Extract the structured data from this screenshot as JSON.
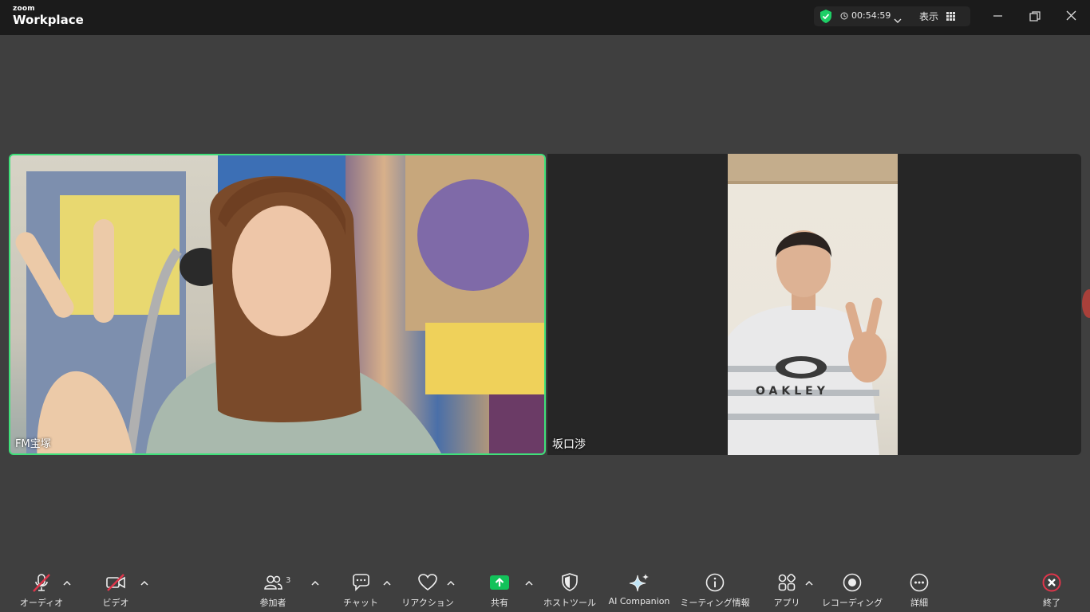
{
  "app": {
    "brand_small": "zoom",
    "brand_name": "Workplace"
  },
  "meeting": {
    "elapsed": "00:54:59",
    "view_label": "表示"
  },
  "participants": [
    {
      "name": "FM宝塚",
      "active_speaker": true
    },
    {
      "name": "坂口渉",
      "active_speaker": false
    }
  ],
  "toolbar": {
    "audio": "オーディオ",
    "video": "ビデオ",
    "participants": "参加者",
    "participants_count": "3",
    "chat": "チャット",
    "reactions": "リアクション",
    "share": "共有",
    "host_tools": "ホストツール",
    "ai_companion": "AI Companion",
    "meeting_info": "ミーティング情報",
    "apps": "アプリ",
    "recording": "レコーディング",
    "more": "詳細",
    "end": "終了"
  },
  "colors": {
    "active_border": "#3fe07a",
    "share_green": "#12c25a",
    "muted_red": "#e0354a",
    "end_red": "#e0354a",
    "shield_green": "#1ecf66"
  },
  "icons": {
    "audio": "microphone-muted-icon",
    "video": "camera-off-icon",
    "participants": "people-icon",
    "chat": "chat-bubble-icon",
    "reactions": "heart-icon",
    "share": "share-arrow-icon",
    "host_tools": "shield-icon",
    "ai_companion": "sparkle-icon",
    "meeting_info": "info-icon",
    "apps": "apps-icon",
    "recording": "record-icon",
    "more": "more-dots-icon",
    "end": "close-icon"
  }
}
